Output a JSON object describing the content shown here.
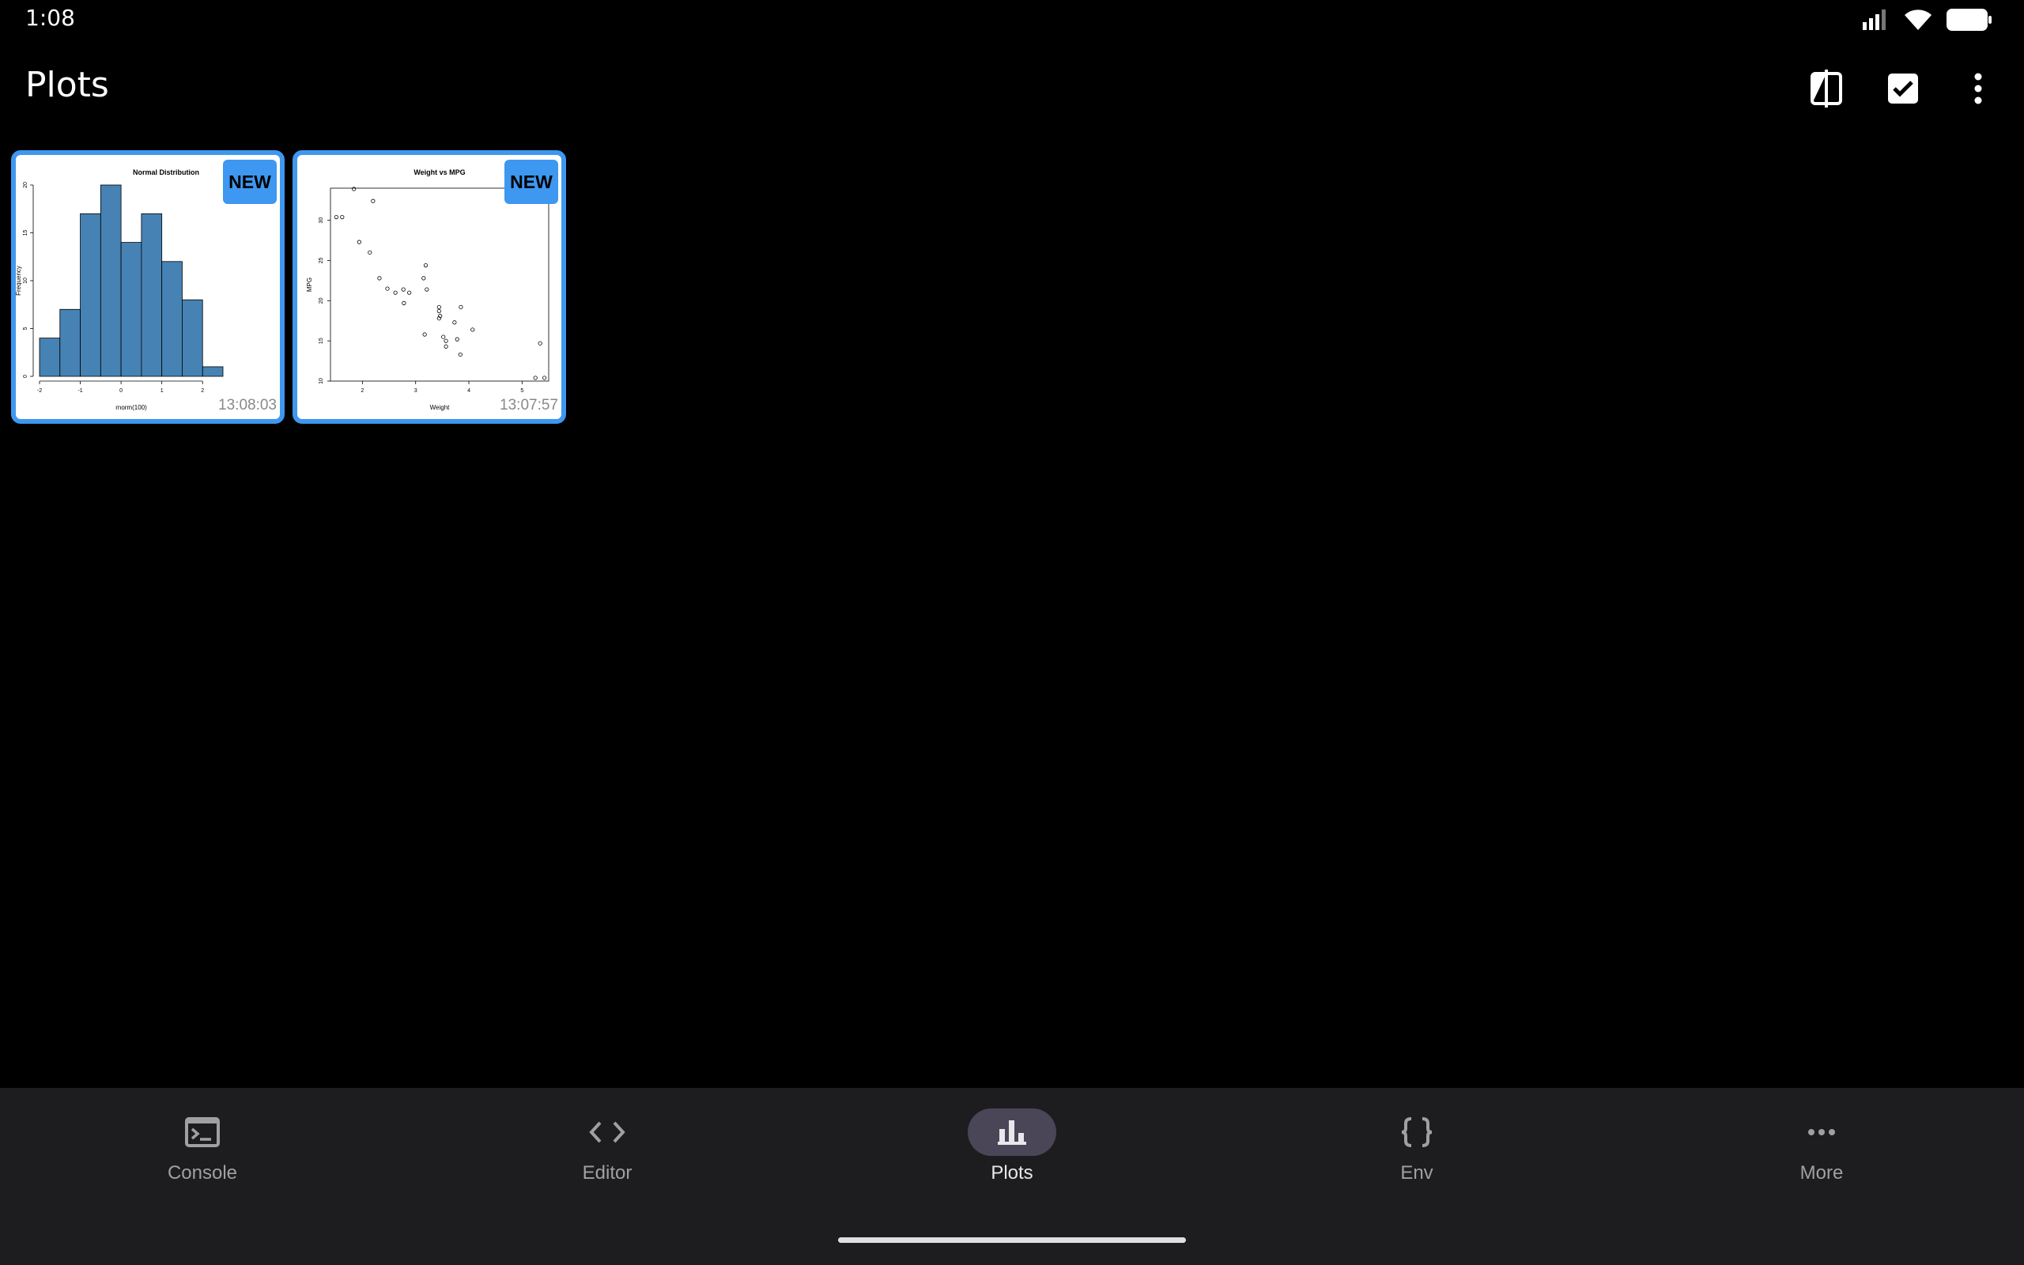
{
  "status": {
    "time": "1:08"
  },
  "header": {
    "title": "Plots"
  },
  "actions": [
    {
      "icon": "split-view-icon"
    },
    {
      "icon": "select-all-icon"
    },
    {
      "icon": "more-vert-icon"
    }
  ],
  "colors": {
    "accent": "#3e97f0",
    "bar_fill": "#4682b4",
    "nav_bg": "#1d1d1f",
    "nav_active_pill": "#4a4658"
  },
  "plots": [
    {
      "badge": "NEW",
      "time": "13:08:03",
      "chart_data": {
        "type": "bar",
        "title": "Normal Distribution",
        "xlabel": "rnorm(100)",
        "ylabel": "Frequency",
        "bins": [
          -2.0,
          -1.5,
          -1.0,
          -0.5,
          0.0,
          0.5,
          1.0,
          1.5,
          2.0,
          2.5
        ],
        "values": [
          4,
          7,
          17,
          20,
          14,
          17,
          12,
          8,
          1
        ],
        "xticks": [
          "-2",
          "-1",
          "0",
          "1",
          "2"
        ],
        "yticks": [
          "0",
          "5",
          "10",
          "15",
          "20"
        ],
        "ylim": [
          0,
          20
        ]
      }
    },
    {
      "badge": "NEW",
      "time": "13:07:57",
      "chart_data": {
        "type": "scatter",
        "title": "Weight vs MPG",
        "xlabel": "Weight",
        "ylabel": "MPG",
        "xlim": [
          1.4,
          5.5
        ],
        "ylim": [
          10,
          34
        ],
        "xticks": [
          "2",
          "3",
          "4",
          "5"
        ],
        "yticks": [
          "10",
          "15",
          "20",
          "25",
          "30"
        ],
        "points": [
          [
            1.51,
            30.4
          ],
          [
            1.62,
            30.4
          ],
          [
            1.84,
            33.9
          ],
          [
            1.94,
            27.3
          ],
          [
            2.14,
            26.0
          ],
          [
            2.2,
            32.4
          ],
          [
            2.32,
            22.8
          ],
          [
            2.47,
            21.5
          ],
          [
            2.62,
            21.0
          ],
          [
            2.77,
            21.4
          ],
          [
            2.78,
            19.7
          ],
          [
            2.88,
            21.0
          ],
          [
            3.15,
            22.8
          ],
          [
            3.17,
            15.8
          ],
          [
            3.19,
            24.4
          ],
          [
            3.21,
            21.4
          ],
          [
            3.44,
            18.7
          ],
          [
            3.44,
            19.2
          ],
          [
            3.44,
            17.8
          ],
          [
            3.46,
            18.1
          ],
          [
            3.52,
            15.5
          ],
          [
            3.57,
            15.0
          ],
          [
            3.57,
            14.3
          ],
          [
            3.73,
            17.3
          ],
          [
            3.78,
            15.2
          ],
          [
            3.84,
            13.3
          ],
          [
            3.85,
            19.2
          ],
          [
            4.07,
            16.4
          ],
          [
            5.25,
            10.4
          ],
          [
            5.34,
            14.7
          ],
          [
            5.42,
            10.4
          ]
        ]
      }
    }
  ],
  "nav": [
    {
      "label": "Console",
      "icon": "terminal-icon",
      "active": false
    },
    {
      "label": "Editor",
      "icon": "code-icon",
      "active": false
    },
    {
      "label": "Plots",
      "icon": "bar-chart-icon",
      "active": true
    },
    {
      "label": "Env",
      "icon": "braces-icon",
      "active": false
    },
    {
      "label": "More",
      "icon": "more-horiz-icon",
      "active": false
    }
  ]
}
